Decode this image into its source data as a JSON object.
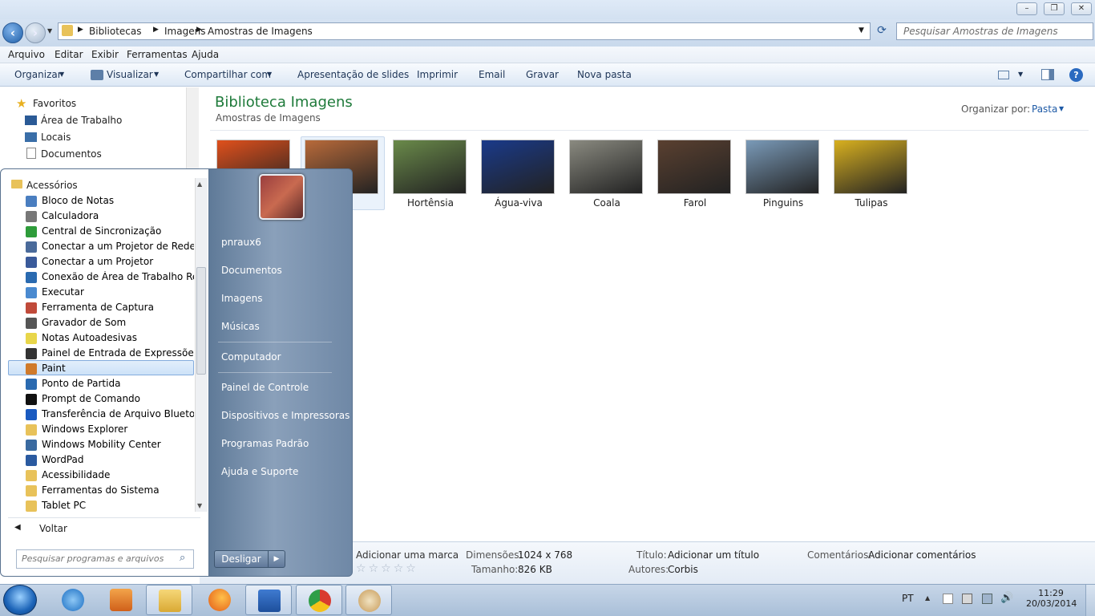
{
  "window": {
    "minimize": "–",
    "maximize": "❐",
    "close": "✕"
  },
  "address": {
    "crumbs": [
      "Bibliotecas",
      "Imagens",
      "Amostras de Imagens"
    ],
    "search_placeholder": "Pesquisar Amostras de Imagens"
  },
  "menubar": [
    "Arquivo",
    "Editar",
    "Exibir",
    "Ferramentas",
    "Ajuda"
  ],
  "toolbar": [
    "Organizar",
    "Visualizar",
    "Compartilhar com",
    "Apresentação de slides",
    "Imprimir",
    "Email",
    "Gravar",
    "Nova pasta"
  ],
  "nav": {
    "favorites": "Favoritos",
    "items": [
      "Área de Trabalho",
      "Locais",
      "Documentos"
    ]
  },
  "content": {
    "title": "Biblioteca Imagens",
    "subtitle": "Amostras de Imagens",
    "sort_label": "Organizar por:",
    "sort_value": "Pasta"
  },
  "thumbnails": [
    {
      "label": "",
      "color": "#e0501c"
    },
    {
      "label": "o",
      "color": "#b86a3a"
    },
    {
      "label": "Hortênsia",
      "color": "#6a8a4a"
    },
    {
      "label": "Água-viva",
      "color": "#1a3a8a"
    },
    {
      "label": "Coala",
      "color": "#8a8a80"
    },
    {
      "label": "Farol",
      "color": "#5a4030"
    },
    {
      "label": "Pinguins",
      "color": "#7a9ab8"
    },
    {
      "label": "Tulipas",
      "color": "#d8b020"
    }
  ],
  "details": {
    "rating_link": "Adicionar uma marca",
    "rating": 0,
    "dim_label": "Dimensões:",
    "dim_value": "1024 x 768",
    "size_label": "Tamanho:",
    "size_value": "826 KB",
    "title_label": "Título:",
    "title_value": "Adicionar um título",
    "authors_label": "Autores:",
    "authors_value": "Corbis",
    "comments_label": "Comentários:",
    "comments_value": "Adicionar comentários"
  },
  "start_menu": {
    "folder": "Acessórios",
    "programs": [
      "Bloco de Notas",
      "Calculadora",
      "Central de Sincronização",
      "Conectar a um Projetor de Rede",
      "Conectar a um Projetor",
      "Conexão de Área de Trabalho Remota",
      "Executar",
      "Ferramenta de Captura",
      "Gravador de Som",
      "Notas Autoadesivas",
      "Painel de Entrada de Expressões Matemáticas",
      "Paint",
      "Ponto de Partida",
      "Prompt de Comando",
      "Transferência de Arquivo Bluetooth",
      "Windows Explorer",
      "Windows Mobility Center",
      "WordPad",
      "Acessibilidade",
      "Ferramentas do Sistema",
      "Tablet PC"
    ],
    "selected": "Paint",
    "back": "Voltar",
    "search_placeholder": "Pesquisar programas e arquivos",
    "right_links": [
      "pnraux6",
      "Documentos",
      "Imagens",
      "Músicas",
      "Computador",
      "Painel de Controle",
      "Dispositivos e Impressoras",
      "Programas Padrão",
      "Ajuda e Suporte"
    ],
    "shutdown": "Desligar"
  },
  "taskbar": {
    "language": "PT",
    "time": "11:29",
    "date": "20/03/2014"
  }
}
